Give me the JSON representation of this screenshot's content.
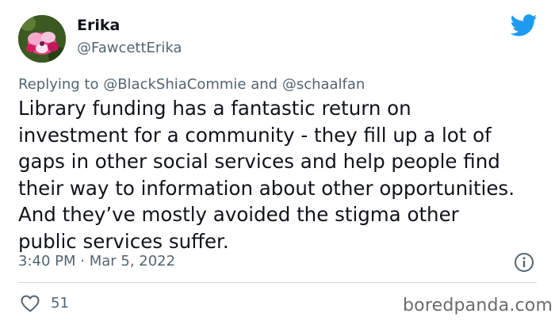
{
  "author": {
    "name": "Erika",
    "handle": "@FawcettErika"
  },
  "reply": {
    "prefix": "Replying to ",
    "mention1": "@BlackShiaCommie",
    "connector": " and ",
    "mention2": "@schaalfan"
  },
  "tweet": {
    "lines": [
      "Library funding has a fantastic return on",
      "investment for a community - they fill up a lot of",
      "gaps in other social services and help people find",
      "their way to information about other opportunities.",
      "And they’ve mostly avoided the stigma other",
      "public services suffer."
    ]
  },
  "meta": {
    "timestamp": "3:40 PM · Mar 5, 2022"
  },
  "stats": {
    "likes": "51"
  },
  "watermark": "boredpanda.com",
  "colors": {
    "twitter_blue": "#1d9bf0",
    "secondary_text": "#536471"
  },
  "icons": {
    "brand": "twitter-bird-icon",
    "info": "info-icon",
    "like": "heart-icon"
  }
}
